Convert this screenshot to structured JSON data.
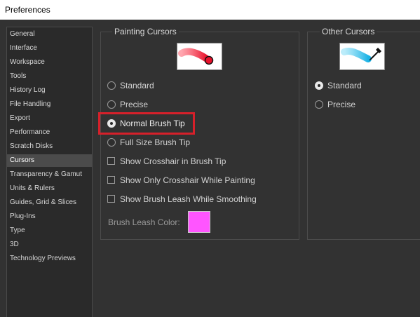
{
  "window": {
    "title": "Preferences"
  },
  "sidebar": {
    "items": [
      {
        "label": "General",
        "selected": false
      },
      {
        "label": "Interface",
        "selected": false
      },
      {
        "label": "Workspace",
        "selected": false
      },
      {
        "label": "Tools",
        "selected": false
      },
      {
        "label": "History Log",
        "selected": false
      },
      {
        "label": "File Handling",
        "selected": false
      },
      {
        "label": "Export",
        "selected": false
      },
      {
        "label": "Performance",
        "selected": false
      },
      {
        "label": "Scratch Disks",
        "selected": false
      },
      {
        "label": "Cursors",
        "selected": true
      },
      {
        "label": "Transparency & Gamut",
        "selected": false
      },
      {
        "label": "Units & Rulers",
        "selected": false
      },
      {
        "label": "Guides, Grid & Slices",
        "selected": false
      },
      {
        "label": "Plug-Ins",
        "selected": false
      },
      {
        "label": "Type",
        "selected": false
      },
      {
        "label": "3D",
        "selected": false
      },
      {
        "label": "Technology Previews",
        "selected": false
      }
    ]
  },
  "painting_cursors": {
    "title": "Painting Cursors",
    "preview_icon": "red-brush-stroke-preview",
    "options": [
      {
        "label": "Standard",
        "selected": false
      },
      {
        "label": "Precise",
        "selected": false
      },
      {
        "label": "Normal Brush Tip",
        "selected": true
      },
      {
        "label": "Full Size Brush Tip",
        "selected": false
      }
    ],
    "checkboxes": [
      {
        "label": "Show Crosshair in Brush Tip",
        "checked": false
      },
      {
        "label": "Show Only Crosshair While Painting",
        "checked": false
      },
      {
        "label": "Show Brush Leash While Smoothing",
        "checked": false
      }
    ],
    "leash_color_label": "Brush Leash Color:",
    "leash_color": "#ff55ff"
  },
  "other_cursors": {
    "title": "Other Cursors",
    "preview_icon": "blue-eyedropper-preview",
    "options": [
      {
        "label": "Standard",
        "selected": true
      },
      {
        "label": "Precise",
        "selected": false
      }
    ]
  },
  "colors": {
    "highlight": "#d6202a",
    "panel_bg": "#323232"
  }
}
